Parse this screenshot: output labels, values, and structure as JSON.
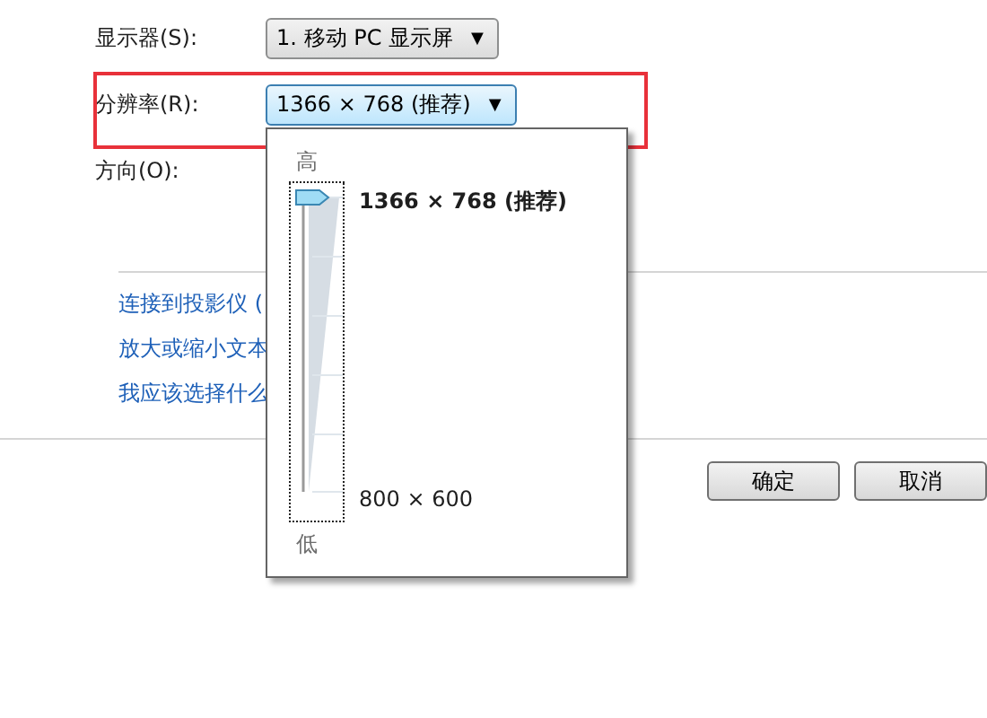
{
  "display": {
    "label": "显示器(S):",
    "value": "1. 移动 PC 显示屏",
    "caret": "▼"
  },
  "resolution": {
    "label": "分辨率(R):",
    "value": "1366 × 768 (推荐)",
    "caret": "▼",
    "highlighted": true,
    "expanded": true
  },
  "orientation": {
    "label": "方向(O):"
  },
  "resolution_popup": {
    "high_label": "高",
    "low_label": "低",
    "top_option": "1366 × 768 (推荐)",
    "bottom_option": "800 × 600",
    "slider": {
      "level": 1
    }
  },
  "links": [
    "连接到投影仪 (",
    "放大或缩小文本",
    "我应该选择什么"
  ],
  "buttons": [
    "确定",
    "取消"
  ]
}
